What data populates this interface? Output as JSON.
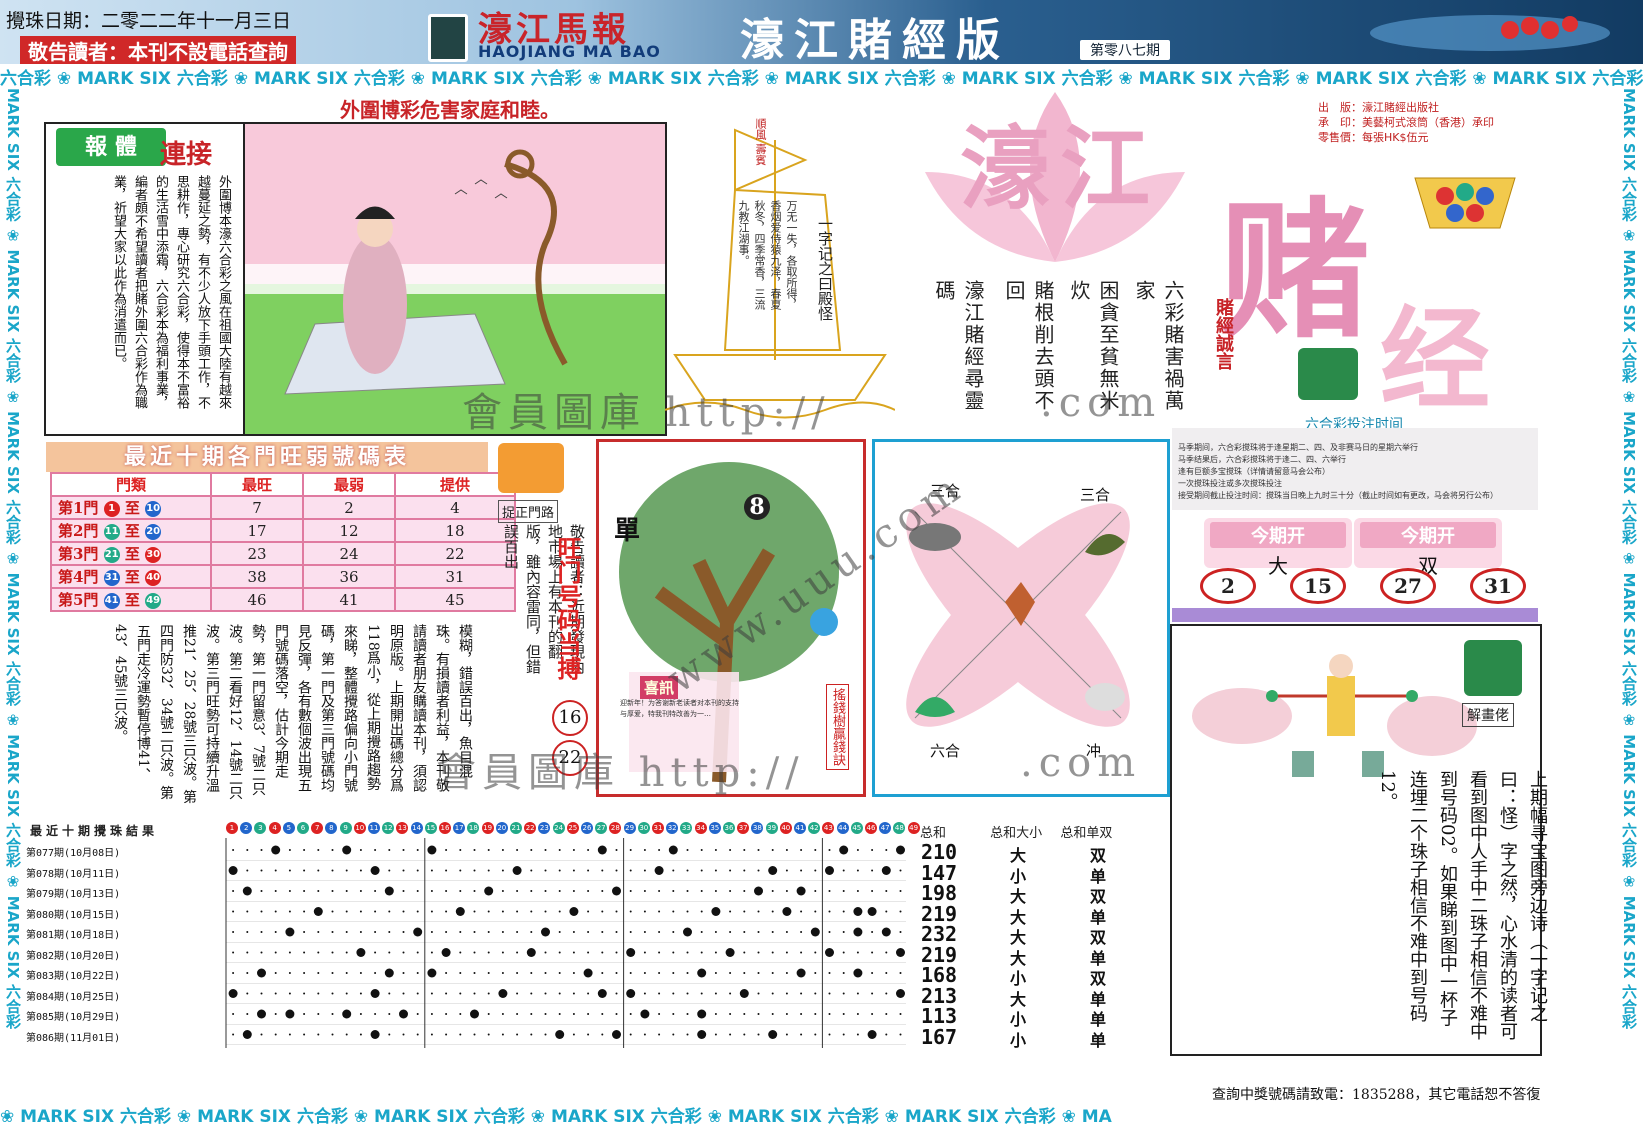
{
  "header": {
    "draw_date": "攪珠日期：二零二二年十一月三日",
    "notice": "敬告讀者：本刊不設電話查詢",
    "logo_cn": "濠江馬報",
    "logo_en": "HAOJIANG MA BAO",
    "edition_title": "濠江賭經版",
    "issue_no": "第零八七期"
  },
  "strip_text": "六合彩 ❀ MARK SIX 六合彩 ❀ MARK SIX 六合彩 ❀ MARK SIX 六合彩 ❀ MARK SIX 六合彩 ❀ MARK SIX 六合彩 ❀ MARK SIX 六合彩 ❀ MARK SIX 六合彩 ❀ MARK SIX 六合彩 ❀ MARK SIX 六合彩 ❀ MARK SIX",
  "strip_bottom_text": "❀ MARK SIX 六合彩 ❀ MARK SIX 六合彩 ❀ MARK SIX 六合彩 ❀ MARK SIX 六合彩 ❀ MARK SIX 六合彩 ❀ MARK SIX 六合彩 ❀ MA",
  "strip_side_text": "MARK SIX 六合彩 ❀ MARK SIX 六合彩 ❀ MARK SIX 六合彩 ❀ MARK SIX 六合彩 ❀ MARK SIX 六合彩 ❀ MARK SIX 六合彩",
  "warning_title": "外圍博彩危害家庭和睦。",
  "article": {
    "badge": "報 體",
    "badge2": "連接",
    "text": "外圍博本濠六合彩之風在祖國大陸有越來越蔓延之勢，有不少人放下手頭工作，不思耕作，專心研究六合彩，使得本不富裕的生活雪中添霜，六合彩本為福利事業，編者頗不希望讀者把賭外圍六合彩作為職業，祈望大家以此作為消遣而已。"
  },
  "boat": {
    "flag": "順風 壽賓",
    "verse_small": "万无一失，各取所得，香烟爱侍猿九泽，春夏秋冬，四季常香，三流九教江湖事。",
    "verse": "一字记之曰殿怪"
  },
  "slogan": {
    "big1": "濠江",
    "big2": "赌",
    "big3": "经"
  },
  "pub_info": [
    "出　版：濠江賭經出版社",
    "承　印：美藝柯式滾筒（香港）承印",
    "零售價：每張HK$伍元"
  ],
  "poem": [
    "六彩賭害禍萬家",
    "困貪至貧無米炊",
    "賭根削去頭不回",
    "濠江賭經尋靈碼"
  ],
  "motto": "賭經誠言",
  "stats": {
    "title": "最近十期各門旺弱號碼表",
    "headers": [
      "門類",
      "最旺",
      "最弱",
      "提供"
    ],
    "rows": [
      {
        "label": "第1門",
        "from": "1",
        "to": "10",
        "max": "7",
        "min": "2",
        "offer": "4"
      },
      {
        "label": "第2門",
        "from": "11",
        "to": "20",
        "max": "17",
        "min": "12",
        "offer": "18"
      },
      {
        "label": "第3門",
        "from": "21",
        "to": "30",
        "max": "23",
        "min": "24",
        "offer": "22"
      },
      {
        "label": "第4門",
        "from": "31",
        "to": "40",
        "max": "38",
        "min": "36",
        "offer": "31"
      },
      {
        "label": "第5門",
        "from": "41",
        "to": "49",
        "max": "46",
        "min": "41",
        "offer": "45"
      }
    ],
    "to_word": "至"
  },
  "prize": {
    "caption": "捉正門路",
    "side_note": "敬告讀者：近期發現內地市場上有本刊的翻版，雖內容雷同，但錯誤百出",
    "lucky_head": "旺门号码当搏",
    "lucky_nums": [
      "16",
      "22"
    ]
  },
  "analysis_text": "模糊，錯誤百出，魚目混珠。有損讀者利益，本刊敬請讀者朋友購讀本刊，須認明原版。上期開出碼總分爲118爲小，從上期攪路趨勢來睇，整體攪路偏向小門號碼，第一門及第三門號碼均見反彈，各有數個波出現五門號碼落空，估計今期走勢，第一門留意3、7號二只波。第二看好12、14號二只波。第三門旺勢可持續升溫推21、25、28號三只波。第四門防32、34號二只波。第五門走冷運勢暫停博41、43、45號三只波。",
  "tree": {
    "single": "單",
    "eight": "8",
    "title": "喜訊",
    "note": "迎新年！为答谢新老读者对本刊的支持与厚爱，特我刊特改善为一…",
    "caption": "搖錢樹贏錢訣"
  },
  "zodiac": {
    "tl": "三合",
    "tr": "三合",
    "bl": "六合",
    "br": "冲"
  },
  "bet": {
    "head": "六合彩投注时间",
    "rules": [
      "马季期间，六合彩搅珠将于逢星期二、四、及非赛马日的星期六举行",
      "马季结果后，六合彩搅珠将于逢二、四、六举行",
      "逢有巨额多宝搅珠（详情请留意马会公布）",
      "一次搅珠投注或多次搅珠投注",
      "接受期间截止投注时间：搅珠当日晚上九时三十分（截止时间如有更改，马会将另行公布）"
    ]
  },
  "open": {
    "head": "今期开",
    "left": "大",
    "right": "双"
  },
  "results_nums": [
    "2",
    "15",
    "27",
    "31"
  ],
  "solve": {
    "caption": "解畫佬",
    "text": "上期幅寻宝图旁边诗（一字记之曰：怪）字之然，心水清的读者可看到图中人手中二珠子相信不难中到号码02。如果睇到图中一杯子连埋二个珠子相信不难中到号码12。"
  },
  "grid": {
    "title": "最近十期攪珠結果",
    "sum_head": "总和",
    "size_head": "总和大小",
    "parity_head": "总和单双",
    "ball_count": 49,
    "rows": [
      {
        "label": "第077期",
        "date": "(10月08日)",
        "sum": "210",
        "size": "大",
        "parity": "双",
        "marks": [
          4,
          9,
          15,
          27,
          32,
          44,
          48
        ]
      },
      {
        "label": "第078期",
        "date": "(10月11日)",
        "sum": "147",
        "size": "小",
        "parity": "单",
        "marks": [
          1,
          11,
          21,
          31,
          39,
          43,
          47
        ]
      },
      {
        "label": "第079期",
        "date": "(10月13日)",
        "sum": "198",
        "size": "大",
        "parity": "双",
        "marks": [
          2,
          12,
          19,
          28,
          38,
          41,
          49
        ]
      },
      {
        "label": "第080期",
        "date": "(10月15日)",
        "sum": "219",
        "size": "大",
        "parity": "单",
        "marks": [
          7,
          17,
          25,
          35,
          40,
          45,
          46
        ]
      },
      {
        "label": "第081期",
        "date": "(10月18日)",
        "sum": "232",
        "size": "大",
        "parity": "双",
        "marks": [
          5,
          14,
          23,
          33,
          42,
          45,
          47
        ]
      },
      {
        "label": "第082期",
        "date": "(10月20日)",
        "sum": "219",
        "size": "大",
        "parity": "单",
        "marks": [
          10,
          16,
          22,
          29,
          36,
          43,
          48
        ]
      },
      {
        "label": "第083期",
        "date": "(10月22日)",
        "sum": "168",
        "size": "小",
        "parity": "双",
        "marks": [
          3,
          12,
          15,
          26,
          34,
          41,
          45
        ]
      },
      {
        "label": "第084期",
        "date": "(10月25日)",
        "sum": "213",
        "size": "大",
        "parity": "单",
        "marks": [
          1,
          11,
          20,
          27,
          29,
          37,
          48
        ]
      },
      {
        "label": "第085期",
        "date": "(10月29日)",
        "sum": "113",
        "size": "小",
        "parity": "单",
        "marks": [
          3,
          5,
          9,
          13,
          18,
          30,
          34
        ]
      },
      {
        "label": "第086期",
        "date": "(11月01日)",
        "sum": "167",
        "size": "小",
        "parity": "单",
        "marks": [
          2,
          11,
          24,
          28,
          34,
          39,
          46
        ]
      }
    ]
  },
  "phone_line": "查詢中獎號碼請致電：1835288，其它電話恕不答復",
  "watermarks": [
    "會員圖庫 http://",
    ".com",
    "會員圖庫 http://",
    ".com",
    "www.uuu.com"
  ],
  "colors": {
    "accent_red": "#c82428",
    "strip_blue": "#1aa6c9",
    "pink": "#e58fb6",
    "zodiac_blue": "#1ea0d2"
  }
}
